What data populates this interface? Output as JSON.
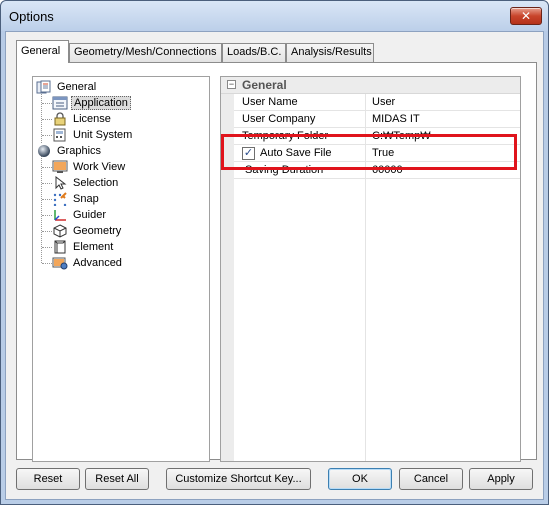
{
  "window": {
    "title": "Options",
    "close_label": "✕"
  },
  "tabs": [
    {
      "label": "General",
      "active": true
    },
    {
      "label": "Geometry/Mesh/Connections",
      "active": false
    },
    {
      "label": "Loads/B.C.",
      "active": false
    },
    {
      "label": "Analysis/Results",
      "active": false
    }
  ],
  "tree": {
    "groups": [
      {
        "label": "General",
        "icon": "general-options-icon",
        "children": [
          {
            "label": "Application",
            "icon": "application-icon",
            "selected": true
          },
          {
            "label": "License",
            "icon": "license-lock-icon",
            "selected": false
          },
          {
            "label": "Unit System",
            "icon": "unit-system-icon",
            "selected": false
          }
        ]
      },
      {
        "label": "Graphics",
        "icon": "graphics-sphere-icon",
        "children": [
          {
            "label": "Work View",
            "icon": "work-view-icon"
          },
          {
            "label": "Selection",
            "icon": "selection-cursor-icon"
          },
          {
            "label": "Snap",
            "icon": "snap-icon"
          },
          {
            "label": "Guider",
            "icon": "guider-axes-icon"
          },
          {
            "label": "Geometry",
            "icon": "geometry-cube-icon"
          },
          {
            "label": "Element",
            "icon": "element-icon"
          },
          {
            "label": "Advanced",
            "icon": "advanced-icon"
          }
        ]
      }
    ]
  },
  "property_grid": {
    "category": "General",
    "collapse_symbol": "⊟",
    "rows": [
      {
        "name": "User Name",
        "value": "User"
      },
      {
        "name": "User Company",
        "value": "MIDAS IT"
      },
      {
        "name": "Temporary Folder",
        "value": "C:₩Temp₩"
      },
      {
        "name": "Auto Save File",
        "value": "True",
        "checked": true
      },
      {
        "name": "Saving Duration",
        "value": "60000"
      }
    ],
    "highlight_color": "#e0141c"
  },
  "buttons": {
    "reset": "Reset",
    "reset_all": "Reset All",
    "customize": "Customize Shortcut Key...",
    "ok": "OK",
    "cancel": "Cancel",
    "apply": "Apply"
  }
}
